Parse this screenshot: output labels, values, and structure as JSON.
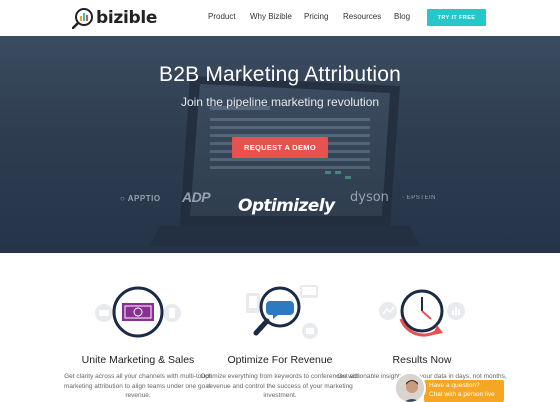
{
  "brand": {
    "name": "bizible",
    "accent": "#27c6c8"
  },
  "nav": {
    "items": [
      {
        "label": "Product"
      },
      {
        "label": "Why Bizible"
      },
      {
        "label": "Pricing"
      },
      {
        "label": "Resources"
      },
      {
        "label": "Blog"
      }
    ],
    "cta_label": "TRY IT FREE"
  },
  "hero": {
    "title": "B2B Marketing Attribution",
    "subtitle": "Join the pipeline marketing revolution",
    "cta_label": "REQUEST A DEMO",
    "cta_color": "#e6524f",
    "clients": [
      "APPTIO",
      "ADP",
      "Optimizely",
      "dyson",
      "EPSTEIN"
    ]
  },
  "features": [
    {
      "title": "Unite Marketing & Sales",
      "description": "Get clarity across all your channels with multi-touch marketing attribution to align teams under one goal: revenue.",
      "icon": "money-target-icon"
    },
    {
      "title": "Optimize For Revenue",
      "description": "Optimize everything from keywords to conferences with revenue and control the success of your marketing investment.",
      "icon": "magnifier-chat-icon"
    },
    {
      "title": "Results Now",
      "description": "Get actionable insights from your data in days, not months, and stop manag",
      "icon": "clock-arrow-icon"
    }
  ],
  "chat": {
    "line1": "Have a question?",
    "line2": "Chat with a person live",
    "color": "#f5a623"
  }
}
